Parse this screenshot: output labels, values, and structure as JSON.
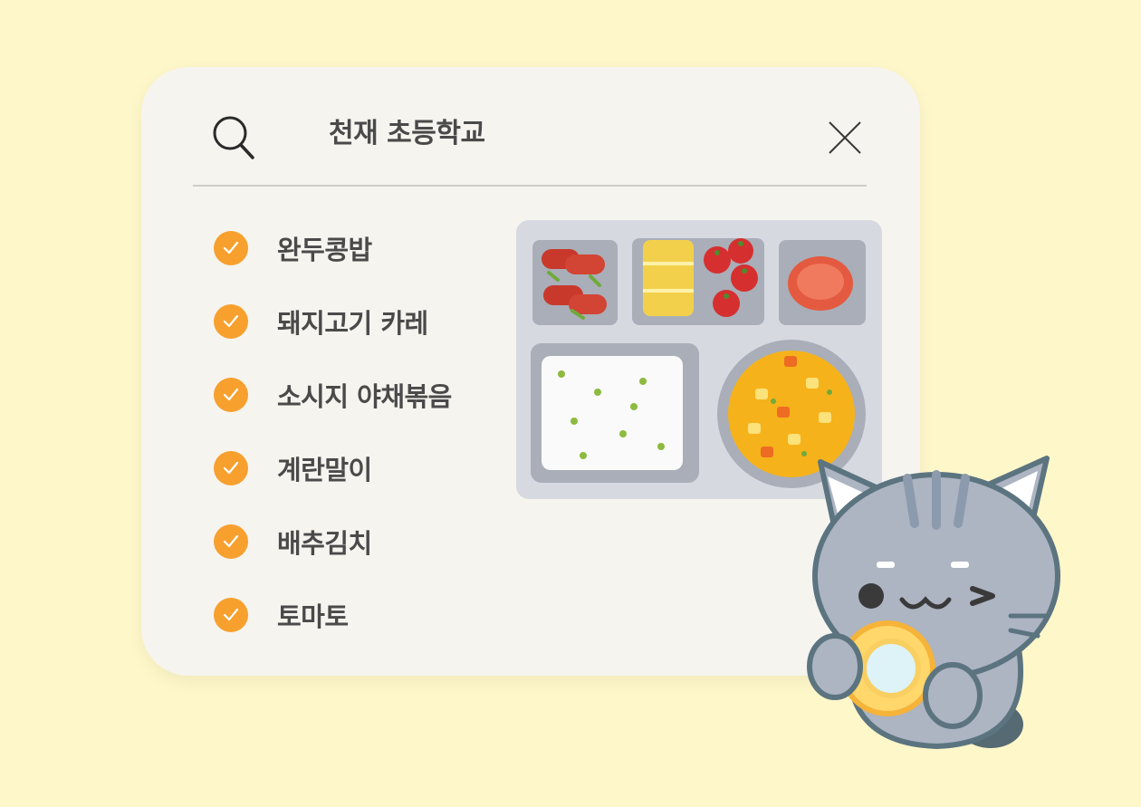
{
  "search": {
    "query": "천재 초등학교",
    "icon": "search-icon",
    "close_icon": "close-icon"
  },
  "menu": {
    "items": [
      {
        "label": "완두콩밥"
      },
      {
        "label": "돼지고기 카레"
      },
      {
        "label": "소시지 야채볶음"
      },
      {
        "label": "계란말이"
      },
      {
        "label": "배추김치"
      },
      {
        "label": "토마토"
      }
    ],
    "check_icon": "check-circle-icon"
  },
  "colors": {
    "background": "#FEF7C9",
    "card": "#F6F4EF",
    "accent": "#F7A02E",
    "text": "#4A4A4A"
  }
}
